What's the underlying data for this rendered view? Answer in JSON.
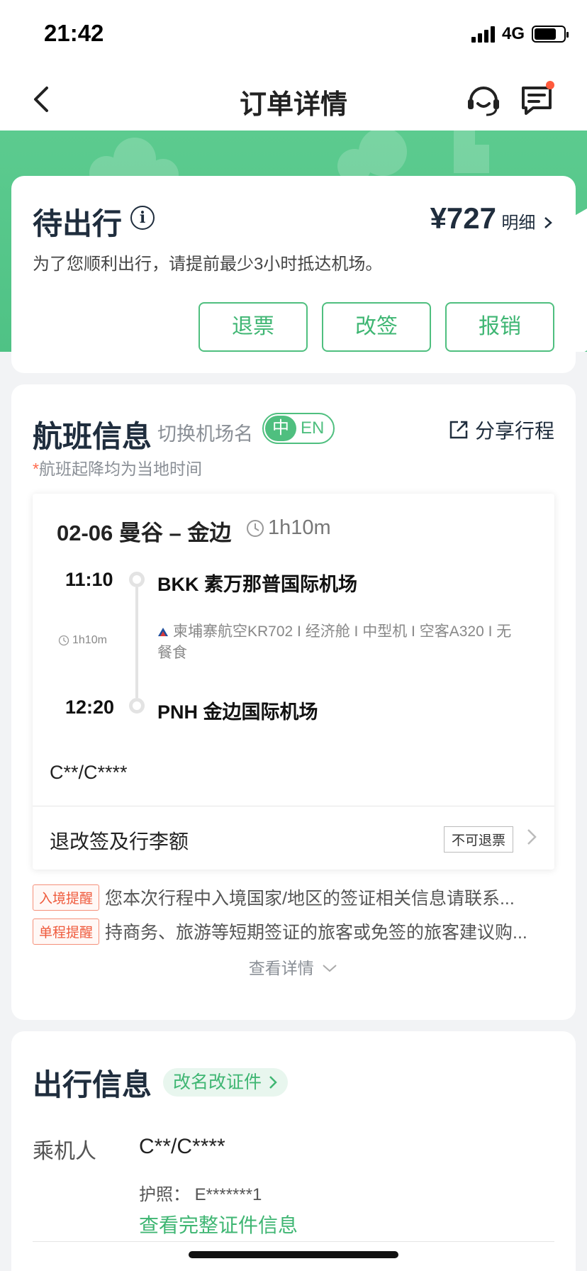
{
  "status_bar": {
    "time": "21:42",
    "network": "4G"
  },
  "nav": {
    "title": "订单详情"
  },
  "order_status": {
    "title": "待出行",
    "price": "¥727",
    "price_detail": "明细",
    "notice": "为了您顺利出行，请提前最少3小时抵达机场。",
    "buttons": [
      "退票",
      "改签",
      "报销"
    ]
  },
  "flight_info": {
    "title": "航班信息",
    "switch_label": "切换机场名",
    "toggle": {
      "zh": "中",
      "en": "EN"
    },
    "share": "分享行程",
    "time_note_star": "*",
    "time_note": "航班起降均为当地时间",
    "segment": {
      "date_route": "02-06 曼谷 – 金边",
      "duration": "1h10m",
      "dep_time": "11:10",
      "dep_airport": "BKK 素万那普国际机场",
      "mid_duration": "1h10m",
      "flight_detail": "柬埔寨航空KR702 I 经济舱 I 中型机 I 空客A320 I 无餐食",
      "arr_time": "12:20",
      "arr_airport": "PNH 金边国际机场",
      "passenger": "C**/C****"
    },
    "rules": {
      "label": "退改签及行李额",
      "badge": "不可退票"
    },
    "tips": [
      {
        "tag": "入境提醒",
        "text": "您本次行程中入境国家/地区的签证相关信息请联系..."
      },
      {
        "tag": "单程提醒",
        "text": "持商务、旅游等短期签证的旅客或免签的旅客建议购..."
      }
    ],
    "view_detail": "查看详情"
  },
  "travel_info": {
    "title": "出行信息",
    "rename": "改名改证件",
    "passenger_label": "乘机人",
    "passenger_name": "C**/C****",
    "passport": "护照：  E*******1",
    "view_id": "查看完整证件信息"
  },
  "colors": {
    "accent": "#4fbf7f",
    "hero": "#5ccb8f",
    "warn": "#ef5a3c",
    "dark_text": "#1f2d3d"
  }
}
